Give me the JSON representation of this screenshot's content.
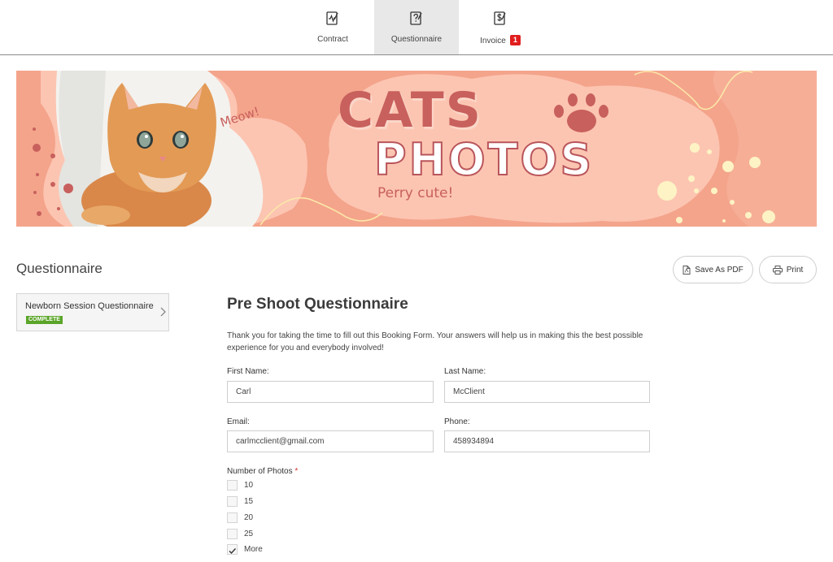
{
  "tabs": [
    {
      "label": "Contract",
      "icon": "contract-icon",
      "active": false
    },
    {
      "label": "Questionnaire",
      "icon": "questionnaire-icon",
      "active": true
    },
    {
      "label": "Invoice",
      "icon": "invoice-icon",
      "active": false,
      "badge": "1"
    }
  ],
  "banner": {
    "title_line1": "CATS",
    "title_line2": "PHOTOS",
    "tagline": "Perry cute!",
    "speech": "Meow!",
    "colors": {
      "background": "#f4a48b",
      "blob": "#fcc5b2",
      "accent": "#c8605d",
      "dots": "#fdf3c4"
    }
  },
  "section": {
    "title": "Questionnaire",
    "save_pdf_label": "Save As PDF",
    "print_label": "Print"
  },
  "sidebar": {
    "item_name": "Newborn Session Questionnaire",
    "item_status": "COMPLETE"
  },
  "form": {
    "title": "Pre Shoot Questionnaire",
    "intro": "Thank you for taking the time to fill out this Booking Form. Your answers will help us in making this the best possible experience for you and everybody involved!",
    "first_name_label": "First Name:",
    "first_name_value": "Carl",
    "last_name_label": "Last Name:",
    "last_name_value": "McClient",
    "email_label": "Email:",
    "email_value": "carlmcclient@gmail.com",
    "phone_label": "Phone:",
    "phone_value": "458934894",
    "photos_label": "Number of Photos",
    "required_mark": "*",
    "photo_options": [
      {
        "label": "10",
        "checked": false
      },
      {
        "label": "15",
        "checked": false
      },
      {
        "label": "20",
        "checked": false
      },
      {
        "label": "25",
        "checked": false
      },
      {
        "label": "More",
        "checked": true
      }
    ]
  },
  "colors": {
    "badge": "#e01e1e",
    "complete": "#5aa529",
    "required": "#d53434"
  }
}
